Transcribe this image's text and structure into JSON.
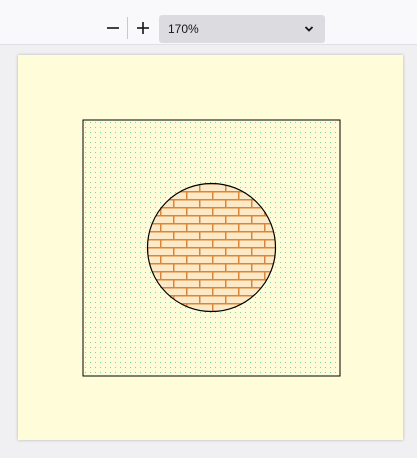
{
  "toolbar": {
    "zoom_out_icon": "minus-icon",
    "zoom_in_icon": "plus-icon",
    "zoom_level": "170%",
    "dropdown_icon": "chevron-down-icon"
  },
  "document": {
    "page_background": "#fffcd9",
    "dot_pattern_color": "#7fd39a",
    "brick_fill": "#fde9c5",
    "brick_mortar": "#d9863a",
    "outline_color": "#000000"
  }
}
